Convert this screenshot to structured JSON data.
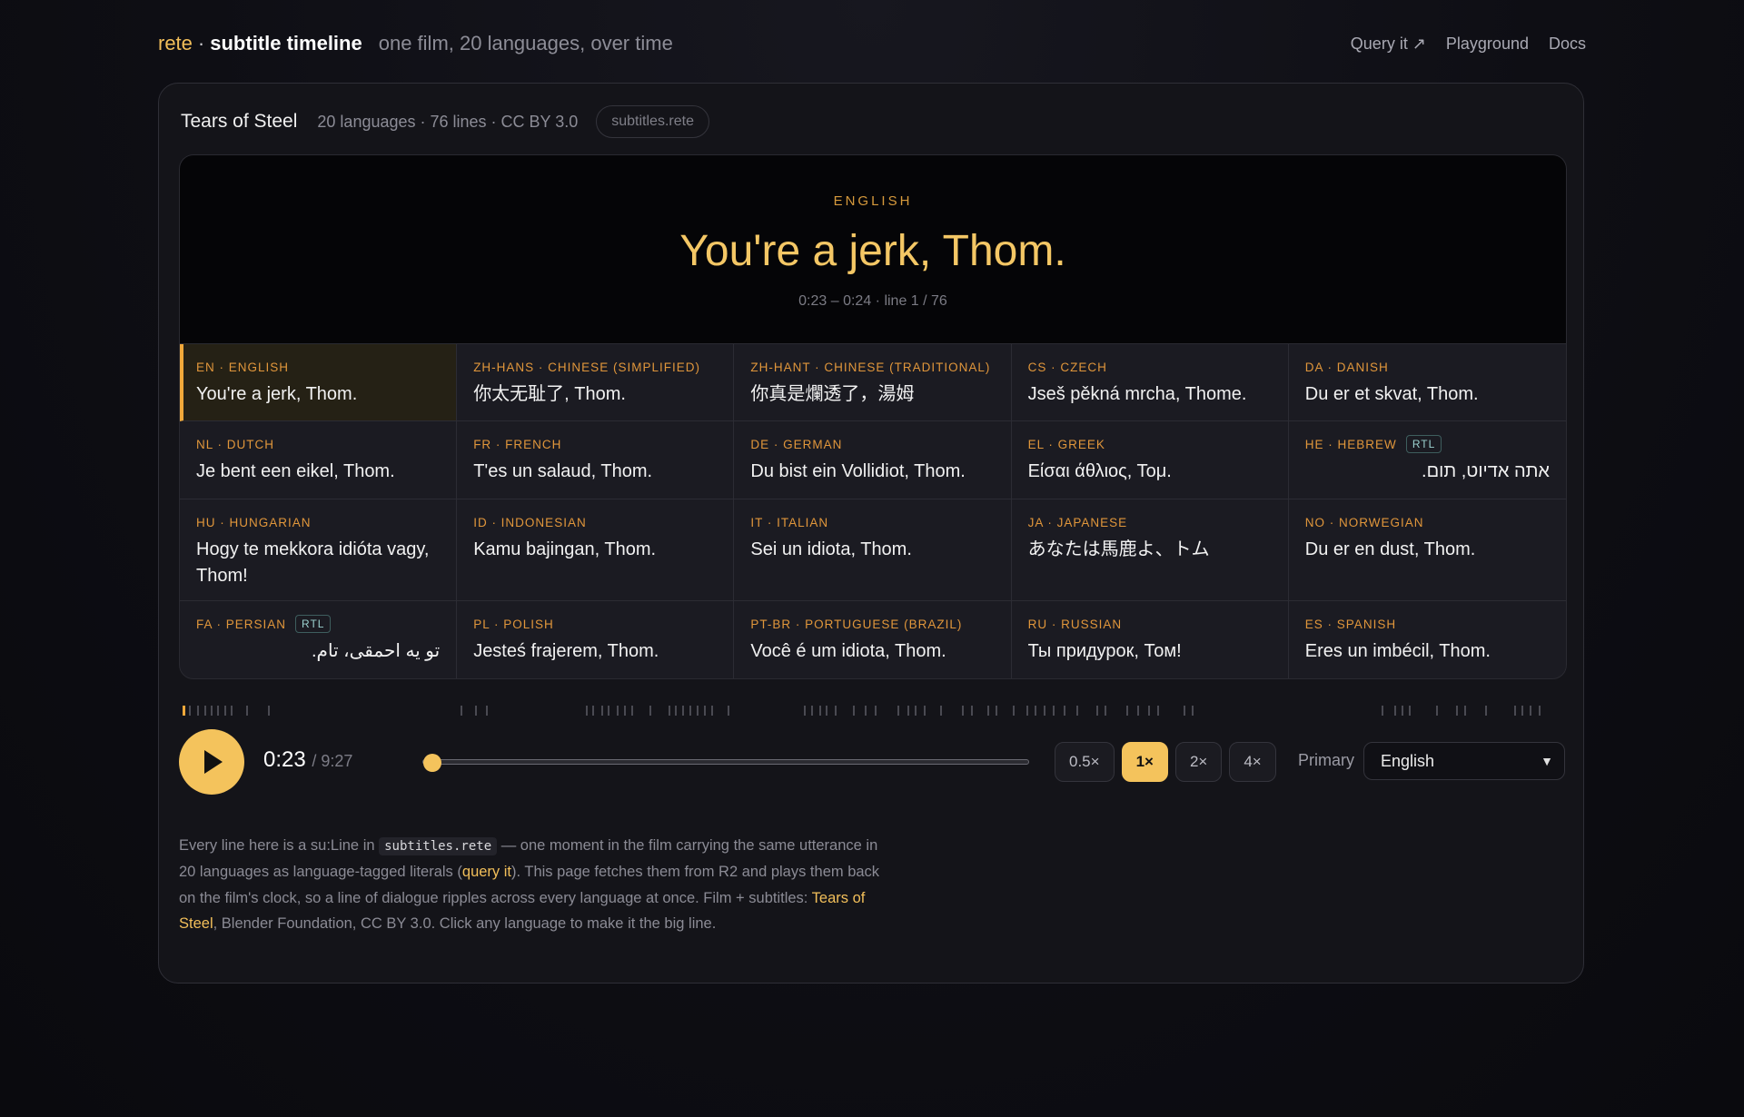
{
  "header": {
    "brand": "rete",
    "separator": "·",
    "product": "subtitle timeline",
    "tagline": "one film, 20 languages, over time",
    "nav": {
      "query": "Query it ↗",
      "playground": "Playground",
      "docs": "Docs"
    }
  },
  "film": {
    "title": "Tears of Steel",
    "meta": "20 languages · 76 lines · CC BY 3.0",
    "source_pill": "subtitles.rete"
  },
  "stage": {
    "language": "ENGLISH",
    "line": "You're a jerk, Thom.",
    "timing": "0:23 – 0:24 · line 1 / 76"
  },
  "languages": [
    {
      "code": "EN · ENGLISH",
      "text": "You're a jerk, Thom.",
      "rtl": false,
      "active": true
    },
    {
      "code": "ZH-HANS · CHINESE (SIMPLIFIED)",
      "text": "你太无耻了, Thom.",
      "rtl": false
    },
    {
      "code": "ZH-HANT · CHINESE (TRADITIONAL)",
      "text": "你真是爛透了，湯姆",
      "rtl": false
    },
    {
      "code": "CS · CZECH",
      "text": "Jseš pěkná mrcha, Thome.",
      "rtl": false
    },
    {
      "code": "DA · DANISH",
      "text": "Du er et skvat, Thom.",
      "rtl": false
    },
    {
      "code": "NL · DUTCH",
      "text": "Je bent een eikel, Thom.",
      "rtl": false
    },
    {
      "code": "FR · FRENCH",
      "text": "T'es un salaud, Thom.",
      "rtl": false
    },
    {
      "code": "DE · GERMAN",
      "text": "Du bist ein Vollidiot, Thom.",
      "rtl": false
    },
    {
      "code": "EL · GREEK",
      "text": "Είσαι άθλιος, Τομ.",
      "rtl": false
    },
    {
      "code": "HE · HEBREW",
      "text": "אתה אדיוט, תום.",
      "rtl": true,
      "badge": "RTL"
    },
    {
      "code": "HU · HUNGARIAN",
      "text": "Hogy te mekkora idióta vagy, Thom!",
      "rtl": false
    },
    {
      "code": "ID · INDONESIAN",
      "text": "Kamu bajingan, Thom.",
      "rtl": false
    },
    {
      "code": "IT · ITALIAN",
      "text": "Sei un idiota, Thom.",
      "rtl": false
    },
    {
      "code": "JA · JAPANESE",
      "text": "あなたは馬鹿よ、トム",
      "rtl": false
    },
    {
      "code": "NO · NORWEGIAN",
      "text": "Du er en dust, Thom.",
      "rtl": false
    },
    {
      "code": "FA · PERSIAN",
      "text": "تو یه احمقی، تام.",
      "rtl": true,
      "badge": "RTL"
    },
    {
      "code": "PL · POLISH",
      "text": "Jesteś frajerem, Thom.",
      "rtl": false
    },
    {
      "code": "PT-BR · PORTUGUESE (BRAZIL)",
      "text": "Você é um idiota, Thom.",
      "rtl": false
    },
    {
      "code": "RU · RUSSIAN",
      "text": "Ты придурок, Том!",
      "rtl": false
    },
    {
      "code": "ES · SPANISH",
      "text": "Eres un imbécil, Thom.",
      "rtl": false
    }
  ],
  "player": {
    "current_time": "0:23",
    "duration": "/ 9:27",
    "progress_fraction": 0.04,
    "speeds": [
      "0.5×",
      "1×",
      "2×",
      "4×"
    ],
    "active_speed": "1×",
    "primary_label": "Primary",
    "primary_value": "English"
  },
  "about": {
    "p1": "Every line here is a su:Line in ",
    "code": "subtitles.rete",
    "p2": " — one moment in the film carrying the same utterance in 20 languages as language-tagged literals (",
    "link1": "query it",
    "p3": "). This page fetches them from R2 and plays them back on the film's clock, so a line of dialogue ripples across every language at once. Film + subtitles: ",
    "link2": "Tears of Steel",
    "p4": ", Blender Foundation, CC BY 3.0. Click any language to make it the big line."
  },
  "colors": {
    "accent": "#f4c35c",
    "label": "#e0963b",
    "background": "#0e0e14"
  }
}
